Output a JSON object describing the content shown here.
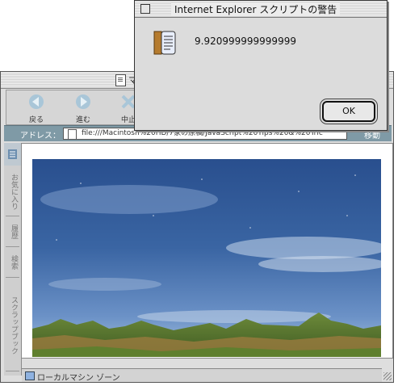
{
  "browser": {
    "title": "マ",
    "toolbar": {
      "back_label": "戻る",
      "forward_label": "進む",
      "stop_label": "中止"
    },
    "address": {
      "label": "アドレス：",
      "url": "file:///Macintosh%20HD/7家の原稿/JavaScript%20Tips%20&%20Tric",
      "go_label": "移動"
    },
    "side_tabs": [
      "お気に入り",
      "履歴",
      "検索",
      "スクラップブック"
    ],
    "status": {
      "zone": "ローカルマシン ゾーン"
    }
  },
  "alert": {
    "title": "Internet Explorer スクリプトの警告",
    "message": "9.920999999999999",
    "ok_label": "OK"
  },
  "colors": {
    "address_bar": "#7f9aa6",
    "sky_top": "#294f8e",
    "sky_bottom": "#a9c4de"
  }
}
